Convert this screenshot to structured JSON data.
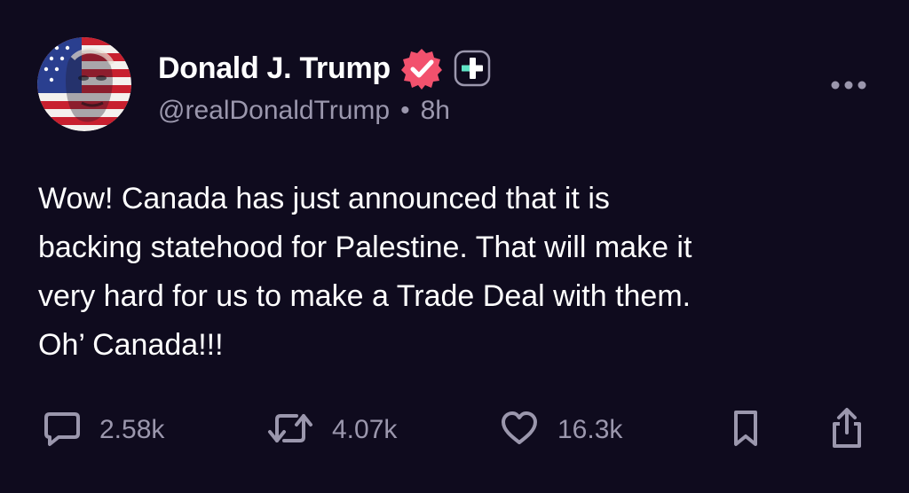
{
  "author": {
    "display_name": "Donald J. Trump",
    "handle": "@realDonaldTrump",
    "separator": "•",
    "time_ago": "8h",
    "verified_badge_icon": "verified-check-icon",
    "verified_badge_color": "#f2516d",
    "plus_badge_icon": "plus-icon",
    "plus_badge_color": "#5fe3c5"
  },
  "post": {
    "lines": [
      "Wow! Canada has just announced that it is",
      "backing statehood for Palestine. That will make it",
      "very hard for us to make a Trade Deal with them.",
      "Oh’ Canada!!!"
    ]
  },
  "actions": {
    "reply": {
      "icon": "comment-icon",
      "count": "2.58k"
    },
    "repost": {
      "icon": "repost-icon",
      "count": "4.07k"
    },
    "like": {
      "icon": "heart-icon",
      "count": "16.3k"
    },
    "bookmark": {
      "icon": "bookmark-icon"
    },
    "share": {
      "icon": "share-icon"
    }
  },
  "menu": {
    "icon": "more-options-icon"
  },
  "colors": {
    "background": "#0f0b1e",
    "text": "#ffffff",
    "muted": "#9b97ad"
  }
}
